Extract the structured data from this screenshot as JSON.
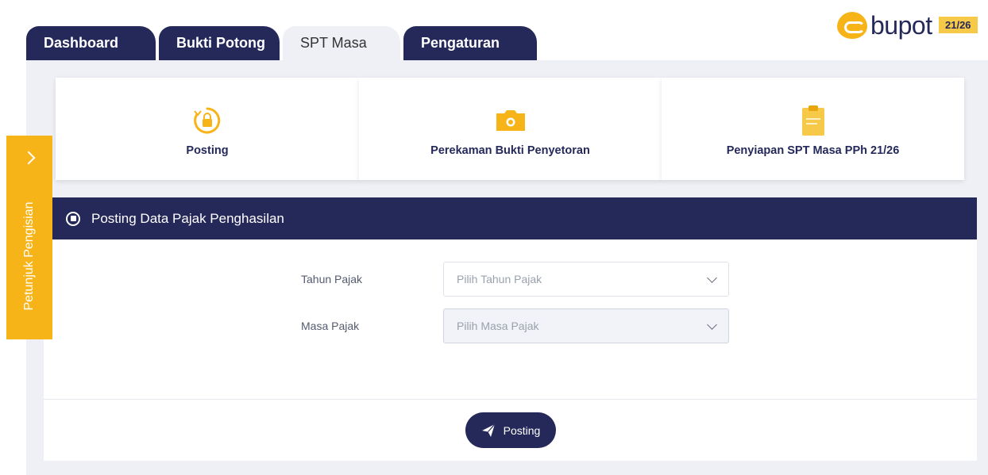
{
  "tabs": [
    {
      "label": "Dashboard",
      "active": false
    },
    {
      "label": "Bukti Potong",
      "active": false
    },
    {
      "label": "SPT Masa",
      "active": true
    },
    {
      "label": "Pengaturan",
      "active": false
    }
  ],
  "logo": {
    "word": "bupot",
    "tag": "21/26"
  },
  "cards": [
    {
      "title": "Posting",
      "icon": "lock-icon"
    },
    {
      "title": "Perekaman Bukti Penyetoran",
      "icon": "camera-icon"
    },
    {
      "title": "Penyiapan SPT Masa PPh 21/26",
      "icon": "clipboard-icon"
    }
  ],
  "form": {
    "heading": "Posting Data Pajak Penghasilan",
    "fields": [
      {
        "label": "Tahun Pajak",
        "placeholder": "Pilih Tahun Pajak"
      },
      {
        "label": "Masa Pajak",
        "placeholder": "Pilih Masa Pajak"
      }
    ],
    "button": "Posting"
  },
  "side_guide": {
    "label": "Petunjuk Pengisian"
  },
  "colors": {
    "primary": "#25295a",
    "accent": "#f7b418",
    "panel": "#eef0f5"
  }
}
